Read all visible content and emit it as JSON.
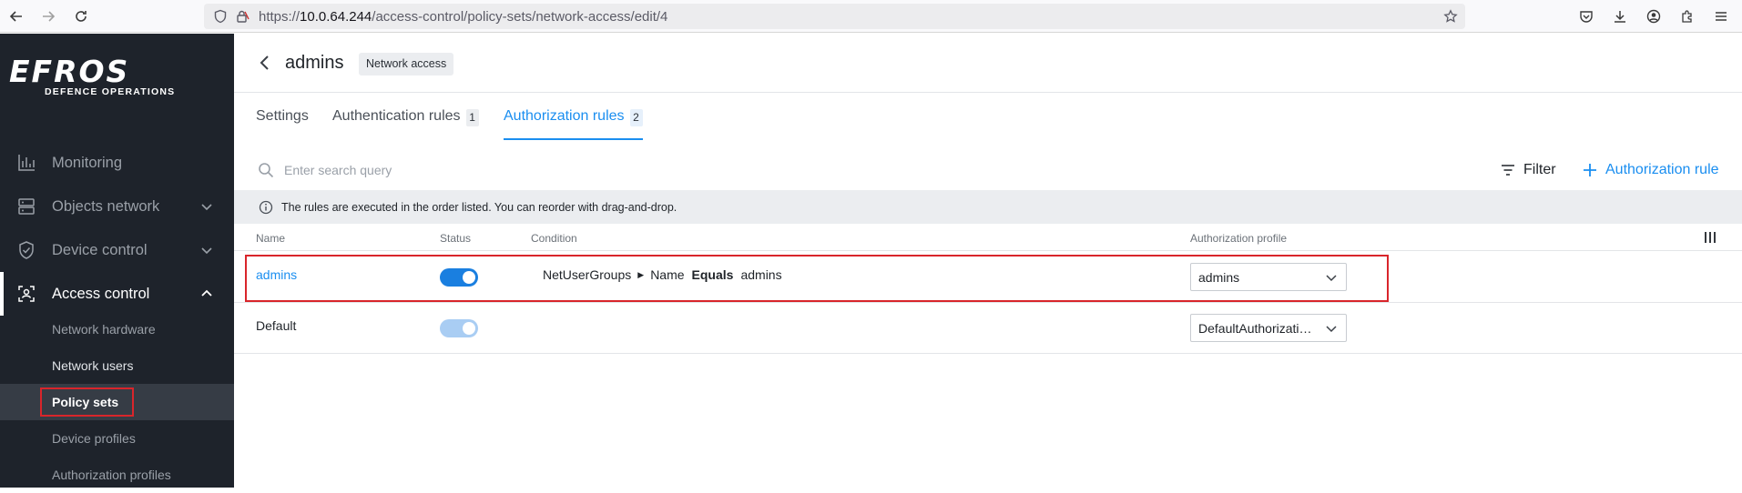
{
  "browser": {
    "url_prefix": "https://",
    "url_host": "10.0.64.244",
    "url_path": "/access-control/policy-sets/network-access/edit/4"
  },
  "sidebar": {
    "logo": {
      "main": "EFROS",
      "sub": "DEFENCE OPERATIONS"
    },
    "items": [
      {
        "label": "Monitoring"
      },
      {
        "label": "Objects network"
      },
      {
        "label": "Device control"
      },
      {
        "label": "Access control"
      }
    ],
    "subitems": [
      {
        "label": "Network hardware"
      },
      {
        "label": "Network users"
      },
      {
        "label": "Policy sets"
      },
      {
        "label": "Device profiles"
      },
      {
        "label": "Authorization profiles"
      }
    ]
  },
  "header": {
    "title": "admins",
    "badge": "Network access"
  },
  "tabs": [
    {
      "label": "Settings",
      "count": ""
    },
    {
      "label": "Authentication rules",
      "count": "1"
    },
    {
      "label": "Authorization rules",
      "count": "2"
    }
  ],
  "toolbar": {
    "search_placeholder": "Enter search query",
    "filter_label": "Filter",
    "add_label": "Authorization rule"
  },
  "info": {
    "text": "The rules are executed in the order listed. You can reorder with drag-and-drop."
  },
  "table": {
    "columns": [
      "Name",
      "Status",
      "Condition",
      "Authorization profile"
    ],
    "rows": [
      {
        "name": "admins",
        "status": "on",
        "condition": {
          "attribute": "NetUserGroups",
          "field": "Name",
          "operator": "Equals",
          "value": "admins"
        },
        "profile": "admins"
      },
      {
        "name": "Default",
        "status": "on-disabled",
        "condition": {
          "attribute": "",
          "field": "",
          "operator": "",
          "value": ""
        },
        "profile": "DefaultAuthorizationProfile"
      }
    ]
  },
  "colors": {
    "accent": "#1a8ef0",
    "sidebar_bg": "#1e232b",
    "highlight": "#d9252b"
  }
}
